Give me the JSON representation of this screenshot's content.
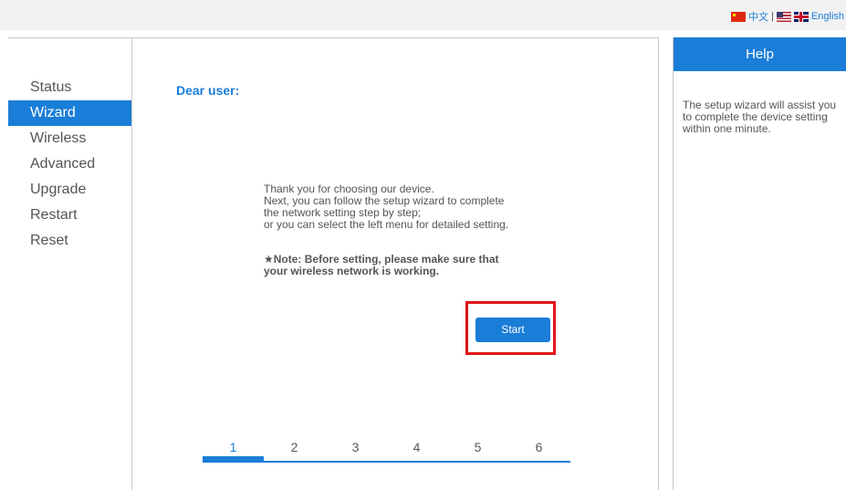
{
  "language": {
    "chinese_label": "中文",
    "separator": "|",
    "english_label": "English"
  },
  "sidebar": {
    "items": [
      {
        "label": "Status"
      },
      {
        "label": "Wizard",
        "active": true
      },
      {
        "label": "Wireless"
      },
      {
        "label": "Advanced"
      },
      {
        "label": "Upgrade"
      },
      {
        "label": "Restart"
      },
      {
        "label": "Reset"
      }
    ]
  },
  "main": {
    "greeting": "Dear user:",
    "intro_lines": [
      "Thank you for choosing our device.",
      "Next, you can follow the setup wizard to complete",
      "the network setting step by step;",
      "or you can select the left menu for detailed setting."
    ],
    "note_lines": [
      "★Note: Before setting, please make sure that",
      "your wireless network is working."
    ],
    "start_label": "Start",
    "steps": [
      "1",
      "2",
      "3",
      "4",
      "5",
      "6"
    ],
    "active_step": 1
  },
  "help": {
    "title": "Help",
    "text": "The setup wizard will assist you to complete the device setting within one minute."
  },
  "colors": {
    "accent": "#1a7dd7",
    "highlight": "#e0141a",
    "text": "#555555"
  }
}
